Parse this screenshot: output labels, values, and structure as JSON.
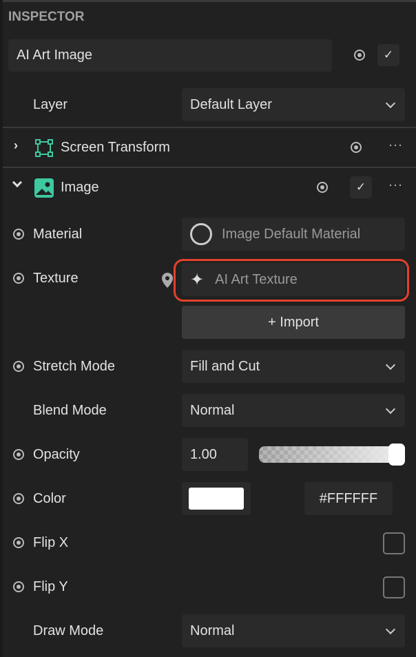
{
  "panel": {
    "title": "INSPECTOR"
  },
  "object": {
    "name": "AI Art Image",
    "enabled": true
  },
  "layer": {
    "label": "Layer",
    "value": "Default Layer"
  },
  "components": [
    {
      "name": "Screen Transform",
      "expanded": false,
      "icon": "screen-transform-icon"
    },
    {
      "name": "Image",
      "expanded": true,
      "icon": "image-icon",
      "enabled": true
    }
  ],
  "image": {
    "material": {
      "label": "Material",
      "value": "Image Default Material"
    },
    "texture": {
      "label": "Texture",
      "value": "AI Art Texture"
    },
    "import_label": "+ Import",
    "stretch_mode": {
      "label": "Stretch Mode",
      "value": "Fill and Cut"
    },
    "blend_mode": {
      "label": "Blend Mode",
      "value": "Normal"
    },
    "opacity": {
      "label": "Opacity",
      "value": "1.00",
      "slider": 1.0
    },
    "color": {
      "label": "Color",
      "value": "#FFFFFF"
    },
    "flip_x": {
      "label": "Flip X",
      "checked": false
    },
    "flip_y": {
      "label": "Flip Y",
      "checked": false
    },
    "draw_mode": {
      "label": "Draw Mode",
      "value": "Normal"
    }
  },
  "colors": {
    "accent": "#3ec9a0",
    "highlight": "#e2412b",
    "bg": "#212121"
  }
}
